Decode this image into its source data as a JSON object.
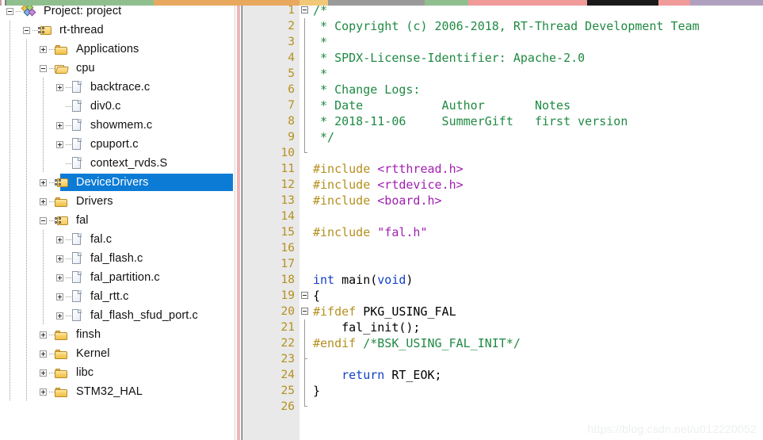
{
  "top_strip": {
    "segments": [
      {
        "color": "#cf9a9e",
        "width": 2
      },
      {
        "color": "#ffffff",
        "width": 4
      },
      {
        "color": "#7f7f7f",
        "width": 2
      },
      {
        "color": "#8fbf8f",
        "width": 186
      },
      {
        "color": "#e8a95e",
        "width": 184
      },
      {
        "color": "#f0c878",
        "width": 36
      },
      {
        "color": "#9a9a9a",
        "width": 122
      },
      {
        "color": "#8fbf8f",
        "width": 55
      },
      {
        "color": "#f09a9a",
        "width": 150
      },
      {
        "color": "#1a1a1a",
        "width": 90
      },
      {
        "color": "#f09a9a",
        "width": 40
      },
      {
        "color": "#b0a0c0",
        "width": 92
      }
    ]
  },
  "project_tree": {
    "panel_name": "Project",
    "selected_node": "DeviceDrivers",
    "selection_color": "#0c7bd6",
    "nodes": [
      {
        "label": "Project: project",
        "depth": 0,
        "icon": "project-icon",
        "expander": "minus"
      },
      {
        "label": "rt-thread",
        "depth": 1,
        "icon": "folder-group-icon",
        "expander": "minus"
      },
      {
        "label": "Applications",
        "depth": 2,
        "icon": "folder-closed-icon",
        "expander": "plus"
      },
      {
        "label": "cpu",
        "depth": 2,
        "icon": "folder-open-icon",
        "expander": "minus"
      },
      {
        "label": "backtrace.c",
        "depth": 3,
        "icon": "file-icon",
        "expander": "plus"
      },
      {
        "label": "div0.c",
        "depth": 3,
        "icon": "file-icon",
        "expander": "none"
      },
      {
        "label": "showmem.c",
        "depth": 3,
        "icon": "file-icon",
        "expander": "plus"
      },
      {
        "label": "cpuport.c",
        "depth": 3,
        "icon": "file-icon",
        "expander": "plus"
      },
      {
        "label": "context_rvds.S",
        "depth": 3,
        "icon": "file-icon",
        "expander": "none"
      },
      {
        "label": "DeviceDrivers",
        "depth": 2,
        "icon": "folder-group-icon",
        "expander": "plus",
        "selected": true
      },
      {
        "label": "Drivers",
        "depth": 2,
        "icon": "folder-closed-icon",
        "expander": "plus"
      },
      {
        "label": "fal",
        "depth": 2,
        "icon": "folder-group-icon",
        "expander": "minus"
      },
      {
        "label": "fal.c",
        "depth": 3,
        "icon": "file-icon",
        "expander": "plus"
      },
      {
        "label": "fal_flash.c",
        "depth": 3,
        "icon": "file-icon",
        "expander": "plus"
      },
      {
        "label": "fal_partition.c",
        "depth": 3,
        "icon": "file-icon",
        "expander": "plus"
      },
      {
        "label": "fal_rtt.c",
        "depth": 3,
        "icon": "file-icon",
        "expander": "plus"
      },
      {
        "label": "fal_flash_sfud_port.c",
        "depth": 3,
        "icon": "file-icon",
        "expander": "plus"
      },
      {
        "label": "finsh",
        "depth": 2,
        "icon": "folder-closed-icon",
        "expander": "plus"
      },
      {
        "label": "Kernel",
        "depth": 2,
        "icon": "folder-closed-icon",
        "expander": "plus"
      },
      {
        "label": "libc",
        "depth": 2,
        "icon": "folder-closed-icon",
        "expander": "plus"
      },
      {
        "label": "STM32_HAL",
        "depth": 2,
        "icon": "folder-closed-icon",
        "expander": "plus"
      }
    ]
  },
  "editor": {
    "language": "c",
    "colors": {
      "comment": "#1f8a43",
      "preprocessor": "#b5901f",
      "header": "#a020b0",
      "keyword": "#1240c8",
      "text": "#000000",
      "gutter_bg": "#e9e9e9",
      "line_number": "#b5901f"
    },
    "line_numbers": [
      1,
      2,
      3,
      4,
      5,
      6,
      7,
      8,
      9,
      10,
      11,
      12,
      13,
      14,
      15,
      16,
      17,
      18,
      19,
      20,
      21,
      22,
      23,
      24,
      25,
      26
    ],
    "lines": [
      {
        "n": 1,
        "fold": "start",
        "tokens": [
          {
            "t": "/*",
            "c": "comment"
          }
        ]
      },
      {
        "n": 2,
        "fold": "body",
        "tokens": [
          {
            "t": " * Copyright (c) 2006-2018, RT-Thread Development Team",
            "c": "comment"
          }
        ]
      },
      {
        "n": 3,
        "fold": "body",
        "tokens": [
          {
            "t": " *",
            "c": "comment"
          }
        ]
      },
      {
        "n": 4,
        "fold": "body",
        "tokens": [
          {
            "t": " * SPDX-License-Identifier: Apache-2.0",
            "c": "comment"
          }
        ]
      },
      {
        "n": 5,
        "fold": "body",
        "tokens": [
          {
            "t": " *",
            "c": "comment"
          }
        ]
      },
      {
        "n": 6,
        "fold": "body",
        "tokens": [
          {
            "t": " * Change Logs:",
            "c": "comment"
          }
        ]
      },
      {
        "n": 7,
        "fold": "body",
        "tokens": [
          {
            "t": " * Date           Author       Notes",
            "c": "comment"
          }
        ]
      },
      {
        "n": 8,
        "fold": "body",
        "tokens": [
          {
            "t": " * 2018-11-06     SummerGift   first version",
            "c": "comment"
          }
        ]
      },
      {
        "n": 9,
        "fold": "body",
        "tokens": [
          {
            "t": " */",
            "c": "comment"
          }
        ]
      },
      {
        "n": 10,
        "fold": "end",
        "tokens": []
      },
      {
        "n": 11,
        "fold": "none",
        "tokens": [
          {
            "t": "#include",
            "c": "pre"
          },
          {
            "t": " ",
            "c": "plain"
          },
          {
            "t": "<rtthread.h>",
            "c": "header"
          }
        ]
      },
      {
        "n": 12,
        "fold": "none",
        "tokens": [
          {
            "t": "#include",
            "c": "pre"
          },
          {
            "t": " ",
            "c": "plain"
          },
          {
            "t": "<rtdevice.h>",
            "c": "header"
          }
        ]
      },
      {
        "n": 13,
        "fold": "none",
        "tokens": [
          {
            "t": "#include",
            "c": "pre"
          },
          {
            "t": " ",
            "c": "plain"
          },
          {
            "t": "<board.h>",
            "c": "header"
          }
        ]
      },
      {
        "n": 14,
        "fold": "none",
        "tokens": []
      },
      {
        "n": 15,
        "fold": "none",
        "tokens": [
          {
            "t": "#include",
            "c": "pre"
          },
          {
            "t": " ",
            "c": "plain"
          },
          {
            "t": "\"fal.h\"",
            "c": "header"
          }
        ]
      },
      {
        "n": 16,
        "fold": "none",
        "tokens": []
      },
      {
        "n": 17,
        "fold": "none",
        "tokens": []
      },
      {
        "n": 18,
        "fold": "none",
        "tokens": [
          {
            "t": "int",
            "c": "kw"
          },
          {
            "t": " main(",
            "c": "plain"
          },
          {
            "t": "void",
            "c": "kw"
          },
          {
            "t": ")",
            "c": "plain"
          }
        ]
      },
      {
        "n": 19,
        "fold": "start",
        "tokens": [
          {
            "t": "{",
            "c": "plain"
          }
        ]
      },
      {
        "n": 20,
        "fold": "start",
        "tokens": [
          {
            "t": "#ifdef",
            "c": "pre"
          },
          {
            "t": " PKG_USING_FAL",
            "c": "plain"
          }
        ]
      },
      {
        "n": 21,
        "fold": "body",
        "tokens": [
          {
            "t": "    fal_init();",
            "c": "plain"
          }
        ]
      },
      {
        "n": 22,
        "fold": "body",
        "tokens": [
          {
            "t": "#endif",
            "c": "pre"
          },
          {
            "t": " ",
            "c": "plain"
          },
          {
            "t": "/*BSK_USING_FAL_INIT*/",
            "c": "comment"
          }
        ]
      },
      {
        "n": 23,
        "fold": "tick",
        "tokens": []
      },
      {
        "n": 24,
        "fold": "body",
        "tokens": [
          {
            "t": "    return ",
            "c": "kw"
          },
          {
            "t": "RT_EOK;",
            "c": "plain"
          }
        ]
      },
      {
        "n": 25,
        "fold": "body",
        "tokens": [
          {
            "t": "}",
            "c": "plain"
          }
        ]
      },
      {
        "n": 26,
        "fold": "end",
        "tokens": []
      }
    ]
  },
  "watermark": {
    "text": "https://blog.csdn.net/u012220052"
  }
}
